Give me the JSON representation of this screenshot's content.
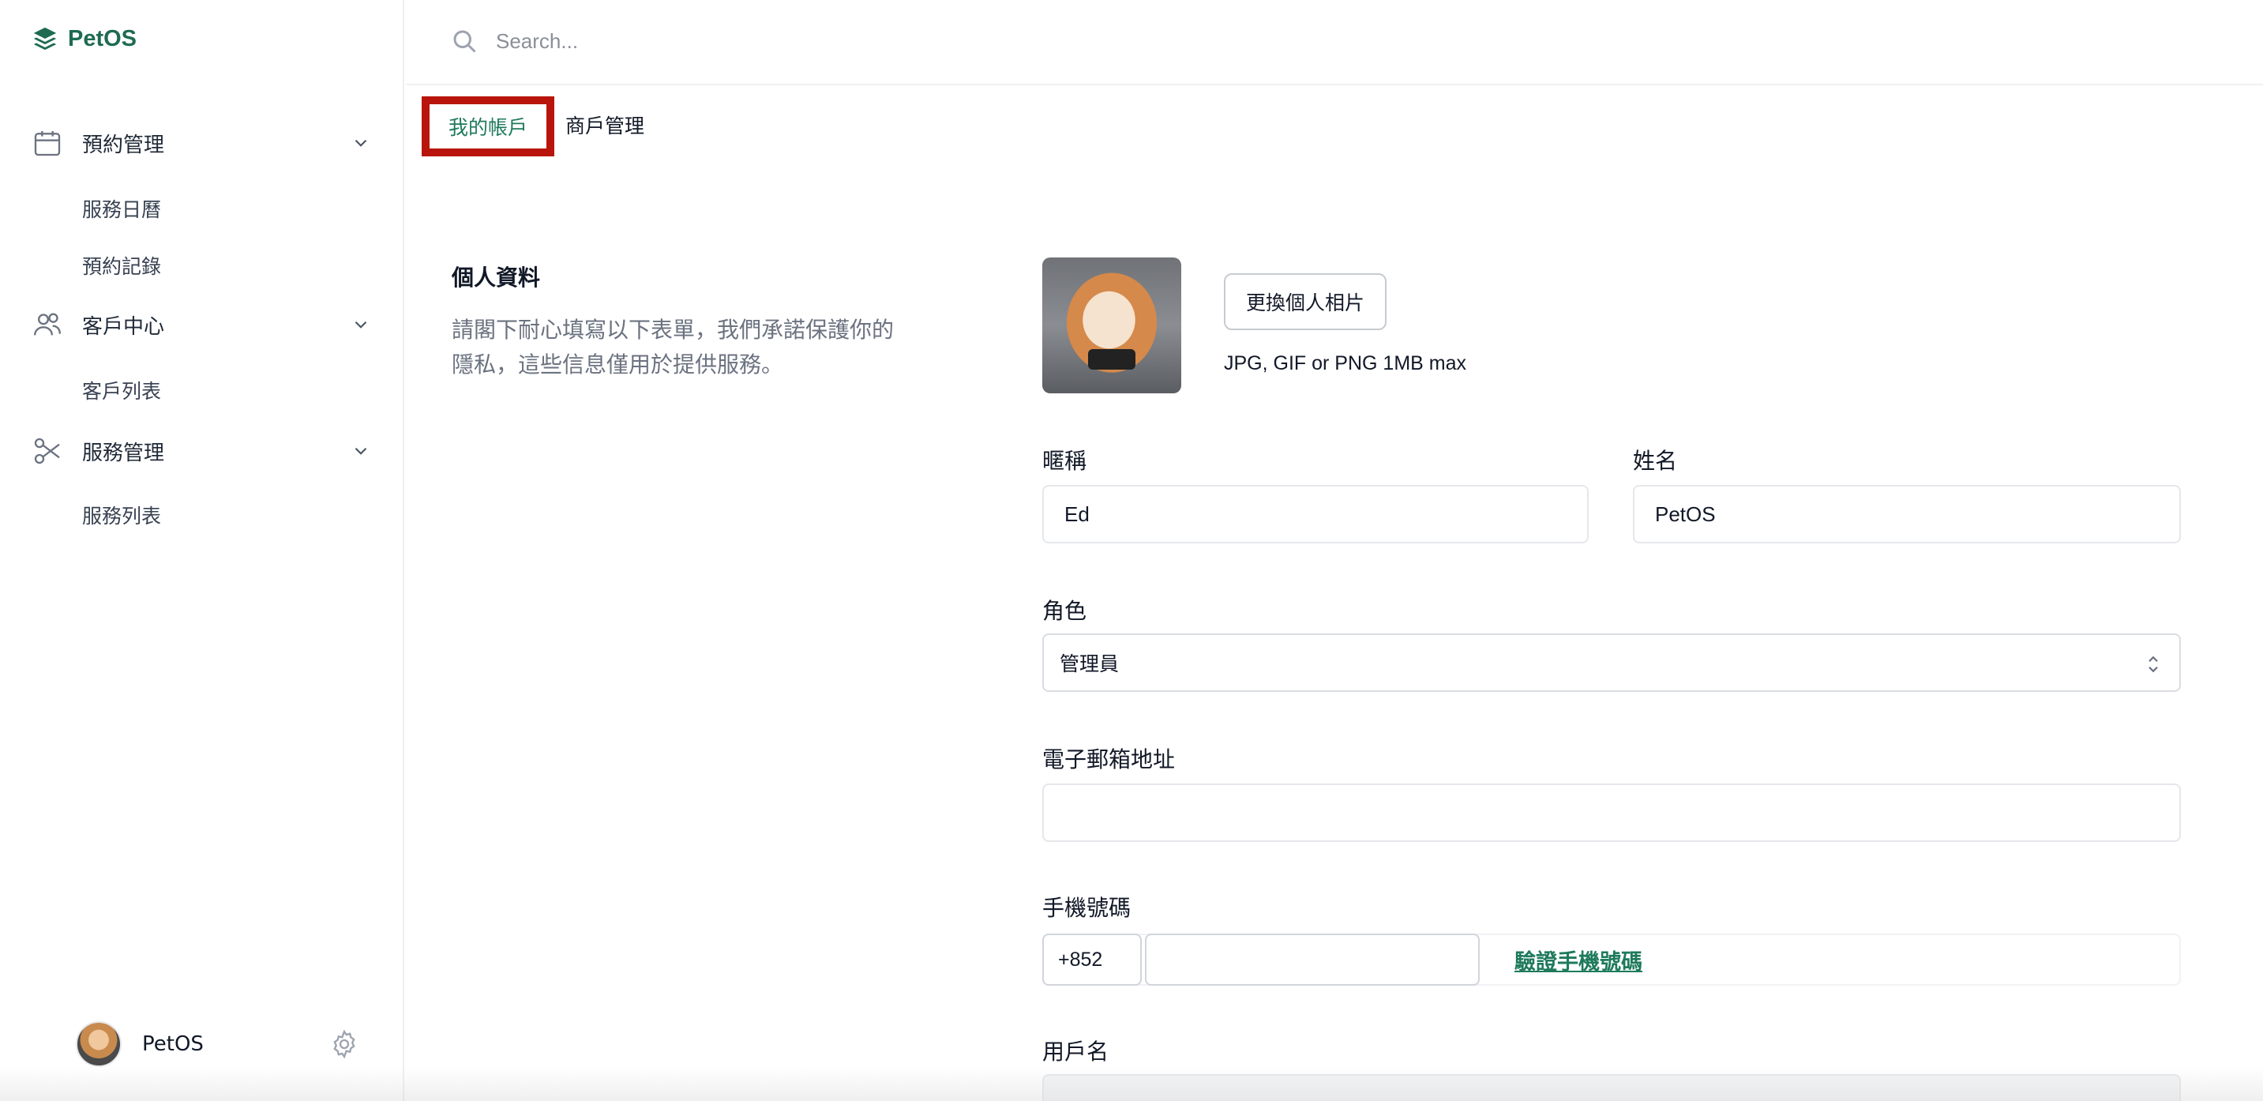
{
  "brand": {
    "name": "PetOS"
  },
  "search": {
    "placeholder": "Search..."
  },
  "sidebar": {
    "groups": [
      {
        "label": "預約管理",
        "icon": "calendar-icon",
        "items": [
          "服務日曆",
          "預約記錄"
        ]
      },
      {
        "label": "客戶中心",
        "icon": "users-icon",
        "items": [
          "客戶列表"
        ]
      },
      {
        "label": "服務管理",
        "icon": "scissors-icon",
        "items": [
          "服務列表"
        ]
      }
    ],
    "user": {
      "name": "PetOS"
    }
  },
  "tabs": {
    "active": "我的帳戶",
    "other": "商戶管理"
  },
  "section": {
    "title": "個人資料",
    "description": "請閣下耐心填寫以下表單，我們承諾保護你的隱私，這些信息僅用於提供服務。"
  },
  "photo": {
    "button": "更換個人相片",
    "hint": "JPG, GIF or PNG 1MB max"
  },
  "form": {
    "nickname": {
      "label": "暱稱",
      "value": "Ed"
    },
    "name": {
      "label": "姓名",
      "value": "PetOS"
    },
    "role": {
      "label": "角色",
      "value": "管理員"
    },
    "email": {
      "label": "電子郵箱地址",
      "value": ""
    },
    "phone": {
      "label": "手機號碼",
      "country_code": "+852",
      "value": "",
      "verify": "驗證手機號碼"
    },
    "username": {
      "label": "用戶名"
    }
  },
  "colors": {
    "brand": "#1e6b52",
    "accent": "#1e7a5c",
    "highlight": "#b8140b"
  }
}
